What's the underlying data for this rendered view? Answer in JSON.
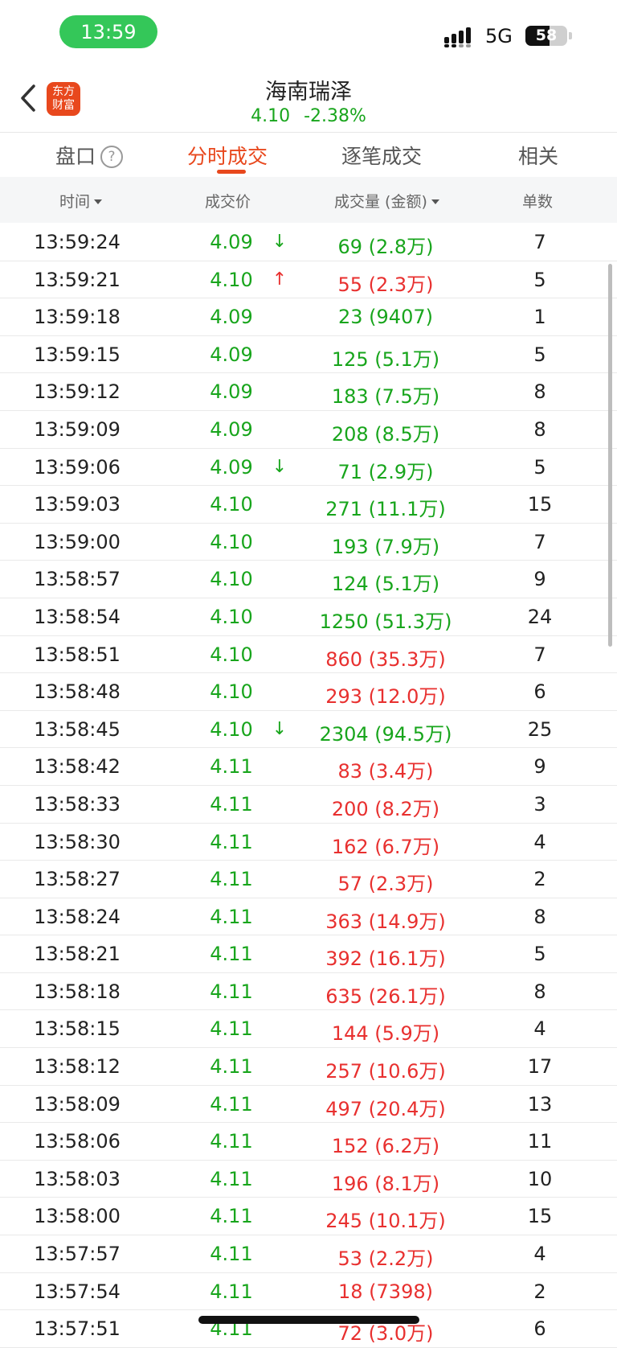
{
  "status_bar": {
    "time": "13:59",
    "network": "5G",
    "battery": "58",
    "battery_level": 0.58
  },
  "header": {
    "title": "海南瑞泽",
    "price": "4.10",
    "change_pct": "-2.38%",
    "logo_line1": "东方",
    "logo_line2": "财富"
  },
  "colors": {
    "up": "#e8302f",
    "down": "#18a51c",
    "accent": "#e8481d"
  },
  "tabs": [
    {
      "label": "盘口"
    },
    {
      "label": "分时成交"
    },
    {
      "label": "逐笔成交"
    },
    {
      "label": "相关"
    }
  ],
  "help_glyph": "?",
  "columns": {
    "time": "时间",
    "price": "成交价",
    "volume": "成交量 (金额)",
    "count": "单数"
  },
  "rows": [
    {
      "time": "13:59:24",
      "price": "4.09",
      "price_dir": "down",
      "arrow": "↓",
      "arrow_dir": "down",
      "volume": "69 (2.8万)",
      "vol_dir": "down",
      "count": "7"
    },
    {
      "time": "13:59:21",
      "price": "4.10",
      "price_dir": "down",
      "arrow": "↑",
      "arrow_dir": "up",
      "volume": "55 (2.3万)",
      "vol_dir": "up",
      "count": "5"
    },
    {
      "time": "13:59:18",
      "price": "4.09",
      "price_dir": "down",
      "arrow": "",
      "arrow_dir": "",
      "volume": "23 (9407)",
      "vol_dir": "down",
      "count": "1"
    },
    {
      "time": "13:59:15",
      "price": "4.09",
      "price_dir": "down",
      "arrow": "",
      "arrow_dir": "",
      "volume": "125 (5.1万)",
      "vol_dir": "down",
      "count": "5"
    },
    {
      "time": "13:59:12",
      "price": "4.09",
      "price_dir": "down",
      "arrow": "",
      "arrow_dir": "",
      "volume": "183 (7.5万)",
      "vol_dir": "down",
      "count": "8"
    },
    {
      "time": "13:59:09",
      "price": "4.09",
      "price_dir": "down",
      "arrow": "",
      "arrow_dir": "",
      "volume": "208 (8.5万)",
      "vol_dir": "down",
      "count": "8"
    },
    {
      "time": "13:59:06",
      "price": "4.09",
      "price_dir": "down",
      "arrow": "↓",
      "arrow_dir": "down",
      "volume": "71 (2.9万)",
      "vol_dir": "down",
      "count": "5"
    },
    {
      "time": "13:59:03",
      "price": "4.10",
      "price_dir": "down",
      "arrow": "",
      "arrow_dir": "",
      "volume": "271 (11.1万)",
      "vol_dir": "down",
      "count": "15"
    },
    {
      "time": "13:59:00",
      "price": "4.10",
      "price_dir": "down",
      "arrow": "",
      "arrow_dir": "",
      "volume": "193 (7.9万)",
      "vol_dir": "down",
      "count": "7"
    },
    {
      "time": "13:58:57",
      "price": "4.10",
      "price_dir": "down",
      "arrow": "",
      "arrow_dir": "",
      "volume": "124 (5.1万)",
      "vol_dir": "down",
      "count": "9"
    },
    {
      "time": "13:58:54",
      "price": "4.10",
      "price_dir": "down",
      "arrow": "",
      "arrow_dir": "",
      "volume": "1250 (51.3万)",
      "vol_dir": "down",
      "count": "24"
    },
    {
      "time": "13:58:51",
      "price": "4.10",
      "price_dir": "down",
      "arrow": "",
      "arrow_dir": "",
      "volume": "860 (35.3万)",
      "vol_dir": "up",
      "count": "7"
    },
    {
      "time": "13:58:48",
      "price": "4.10",
      "price_dir": "down",
      "arrow": "",
      "arrow_dir": "",
      "volume": "293 (12.0万)",
      "vol_dir": "up",
      "count": "6"
    },
    {
      "time": "13:58:45",
      "price": "4.10",
      "price_dir": "down",
      "arrow": "↓",
      "arrow_dir": "down",
      "volume": "2304 (94.5万)",
      "vol_dir": "down",
      "count": "25"
    },
    {
      "time": "13:58:42",
      "price": "4.11",
      "price_dir": "down",
      "arrow": "",
      "arrow_dir": "",
      "volume": "83 (3.4万)",
      "vol_dir": "up",
      "count": "9"
    },
    {
      "time": "13:58:33",
      "price": "4.11",
      "price_dir": "down",
      "arrow": "",
      "arrow_dir": "",
      "volume": "200 (8.2万)",
      "vol_dir": "up",
      "count": "3"
    },
    {
      "time": "13:58:30",
      "price": "4.11",
      "price_dir": "down",
      "arrow": "",
      "arrow_dir": "",
      "volume": "162 (6.7万)",
      "vol_dir": "up",
      "count": "4"
    },
    {
      "time": "13:58:27",
      "price": "4.11",
      "price_dir": "down",
      "arrow": "",
      "arrow_dir": "",
      "volume": "57 (2.3万)",
      "vol_dir": "up",
      "count": "2"
    },
    {
      "time": "13:58:24",
      "price": "4.11",
      "price_dir": "down",
      "arrow": "",
      "arrow_dir": "",
      "volume": "363 (14.9万)",
      "vol_dir": "up",
      "count": "8"
    },
    {
      "time": "13:58:21",
      "price": "4.11",
      "price_dir": "down",
      "arrow": "",
      "arrow_dir": "",
      "volume": "392 (16.1万)",
      "vol_dir": "up",
      "count": "5"
    },
    {
      "time": "13:58:18",
      "price": "4.11",
      "price_dir": "down",
      "arrow": "",
      "arrow_dir": "",
      "volume": "635 (26.1万)",
      "vol_dir": "up",
      "count": "8"
    },
    {
      "time": "13:58:15",
      "price": "4.11",
      "price_dir": "down",
      "arrow": "",
      "arrow_dir": "",
      "volume": "144 (5.9万)",
      "vol_dir": "up",
      "count": "4"
    },
    {
      "time": "13:58:12",
      "price": "4.11",
      "price_dir": "down",
      "arrow": "",
      "arrow_dir": "",
      "volume": "257 (10.6万)",
      "vol_dir": "up",
      "count": "17"
    },
    {
      "time": "13:58:09",
      "price": "4.11",
      "price_dir": "down",
      "arrow": "",
      "arrow_dir": "",
      "volume": "497 (20.4万)",
      "vol_dir": "up",
      "count": "13"
    },
    {
      "time": "13:58:06",
      "price": "4.11",
      "price_dir": "down",
      "arrow": "",
      "arrow_dir": "",
      "volume": "152 (6.2万)",
      "vol_dir": "up",
      "count": "11"
    },
    {
      "time": "13:58:03",
      "price": "4.11",
      "price_dir": "down",
      "arrow": "",
      "arrow_dir": "",
      "volume": "196 (8.1万)",
      "vol_dir": "up",
      "count": "10"
    },
    {
      "time": "13:58:00",
      "price": "4.11",
      "price_dir": "down",
      "arrow": "",
      "arrow_dir": "",
      "volume": "245 (10.1万)",
      "vol_dir": "up",
      "count": "15"
    },
    {
      "time": "13:57:57",
      "price": "4.11",
      "price_dir": "down",
      "arrow": "",
      "arrow_dir": "",
      "volume": "53 (2.2万)",
      "vol_dir": "up",
      "count": "4"
    },
    {
      "time": "13:57:54",
      "price": "4.11",
      "price_dir": "down",
      "arrow": "",
      "arrow_dir": "",
      "volume": "18 (7398)",
      "vol_dir": "up",
      "count": "2"
    },
    {
      "time": "13:57:51",
      "price": "4.11",
      "price_dir": "down",
      "arrow": "",
      "arrow_dir": "",
      "volume": "72 (3.0万)",
      "vol_dir": "up",
      "count": "6"
    }
  ]
}
